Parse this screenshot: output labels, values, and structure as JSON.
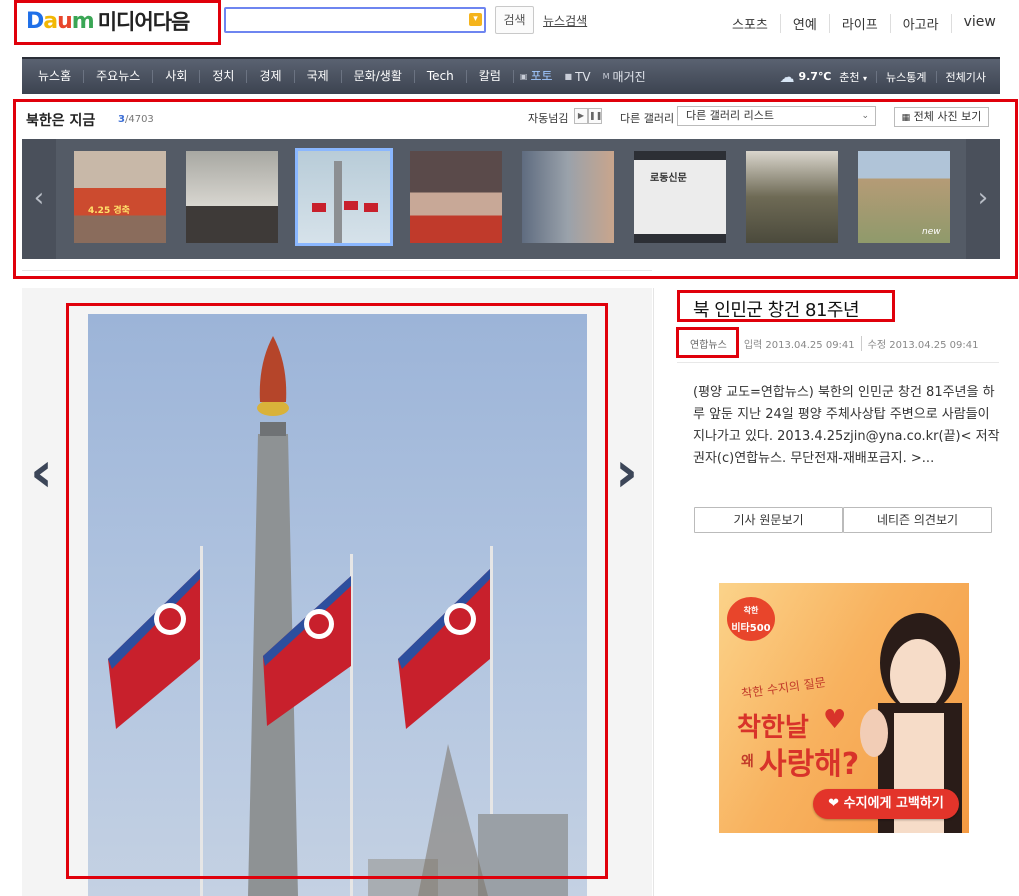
{
  "header": {
    "logo_brand": "Daum",
    "logo_text": "미디어다음",
    "search_placeholder": "",
    "search_button": "검색",
    "news_search_link": "뉴스검색",
    "top_links": [
      "스포츠",
      "연예",
      "라이프",
      "아고라",
      "view"
    ]
  },
  "nav": {
    "items": [
      "뉴스홈",
      "주요뉴스",
      "사회",
      "정치",
      "경제",
      "국제",
      "문화/생활",
      "Tech",
      "칼럼"
    ],
    "media": [
      {
        "icon": "camera-icon",
        "label": "포토",
        "active": true
      },
      {
        "icon": "tv-icon",
        "label": "TV",
        "active": false
      },
      {
        "icon": "magazine-icon",
        "label": "매거진",
        "active": false
      }
    ],
    "weather_temp": "9.7℃",
    "weather_city": "춘천",
    "weather_icon": "cloud-sun-icon",
    "right_links": [
      "뉴스통계",
      "전체기사"
    ]
  },
  "gallery": {
    "title": "북한은 지금",
    "current": "3",
    "total": "/4703",
    "autoplay_label": "자동넘김",
    "other_gallery_label": "다른 갤러리",
    "other_gallery_selected": "다른 갤러리 리스트",
    "all_photos_button": "전체 사진 보기",
    "selected_index": 2,
    "thumb_texts": [
      "4.25 경축",
      "",
      "",
      "",
      "",
      "로동신문",
      "",
      "new"
    ]
  },
  "article": {
    "title": "북 인민군 창건 81주년",
    "source": "연합뉴스",
    "input_date": "입력 2013.04.25 09:41",
    "edit_date": "수정 2013.04.25 09:41",
    "body": "(평양 교도=연합뉴스) 북한의 인민군 창건 81주년을 하루 앞둔 지난 24일 평양 주체사상탑 주변으로 사람들이 지나가고 있다. 2013.4.25zjin@yna.co.kr(끝)< 저작권자(c)연합뉴스. 무단전재-재배포금지. >...",
    "btn_original": "기사 원문보기",
    "btn_netizen": "네티즌 의견보기"
  },
  "ad": {
    "brand_top": "착한",
    "brand_bottom": "비타500",
    "question": "착한 수지의 질문",
    "headline_a": "착한",
    "headline_b": "날",
    "headline_c": "왜",
    "headline_d": "사랑해?",
    "cta": "수지에게 고백하기"
  },
  "colors": {
    "highlight_box": "#e0000b",
    "nav_bg": "#4a505b",
    "accent_blue": "#3d6fd6"
  }
}
